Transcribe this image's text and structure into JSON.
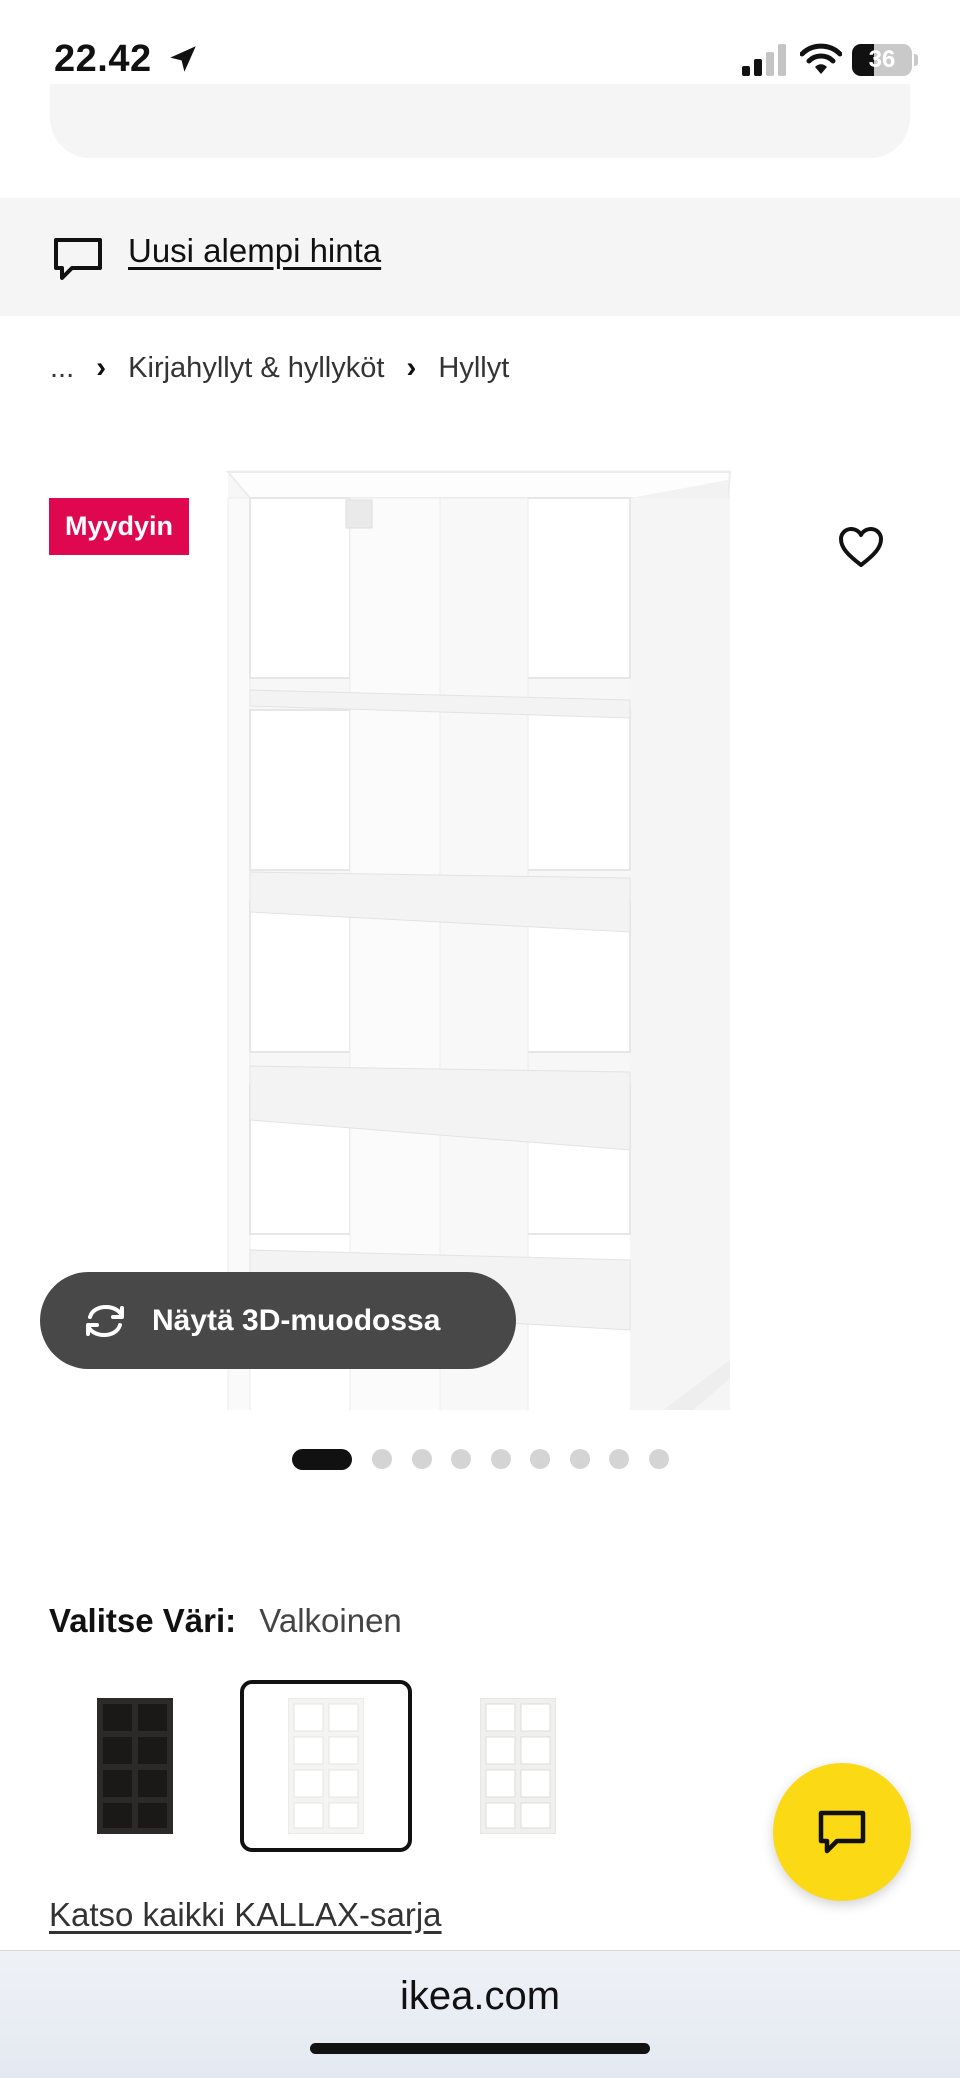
{
  "status_bar": {
    "time": "22.42",
    "battery": "36",
    "battery_level": 0.36
  },
  "banner": {
    "link_text": "Uusi alempi hinta"
  },
  "breadcrumb": {
    "ellipsis": "...",
    "items": [
      "Kirjahyllyt & hyllyköt",
      "Hyllyt"
    ]
  },
  "product": {
    "badge": "Myydyin",
    "view_3d_label": "Näytä 3D-muodossa",
    "image_count": 9,
    "active_image": 1
  },
  "color_picker": {
    "label": "Valitse Väri:",
    "selected": "Valkoinen",
    "options": [
      {
        "color": "#2b2a28"
      },
      {
        "color": "#f4f4f2",
        "selected": true
      },
      {
        "color": "#f0f0ee"
      }
    ]
  },
  "series_link": "Katso kaikki KALLAX-sarja",
  "browser": {
    "url": "ikea.com"
  },
  "colors": {
    "badge": "#e00751",
    "chat_fab": "#fbd914",
    "pill": "#484848"
  }
}
